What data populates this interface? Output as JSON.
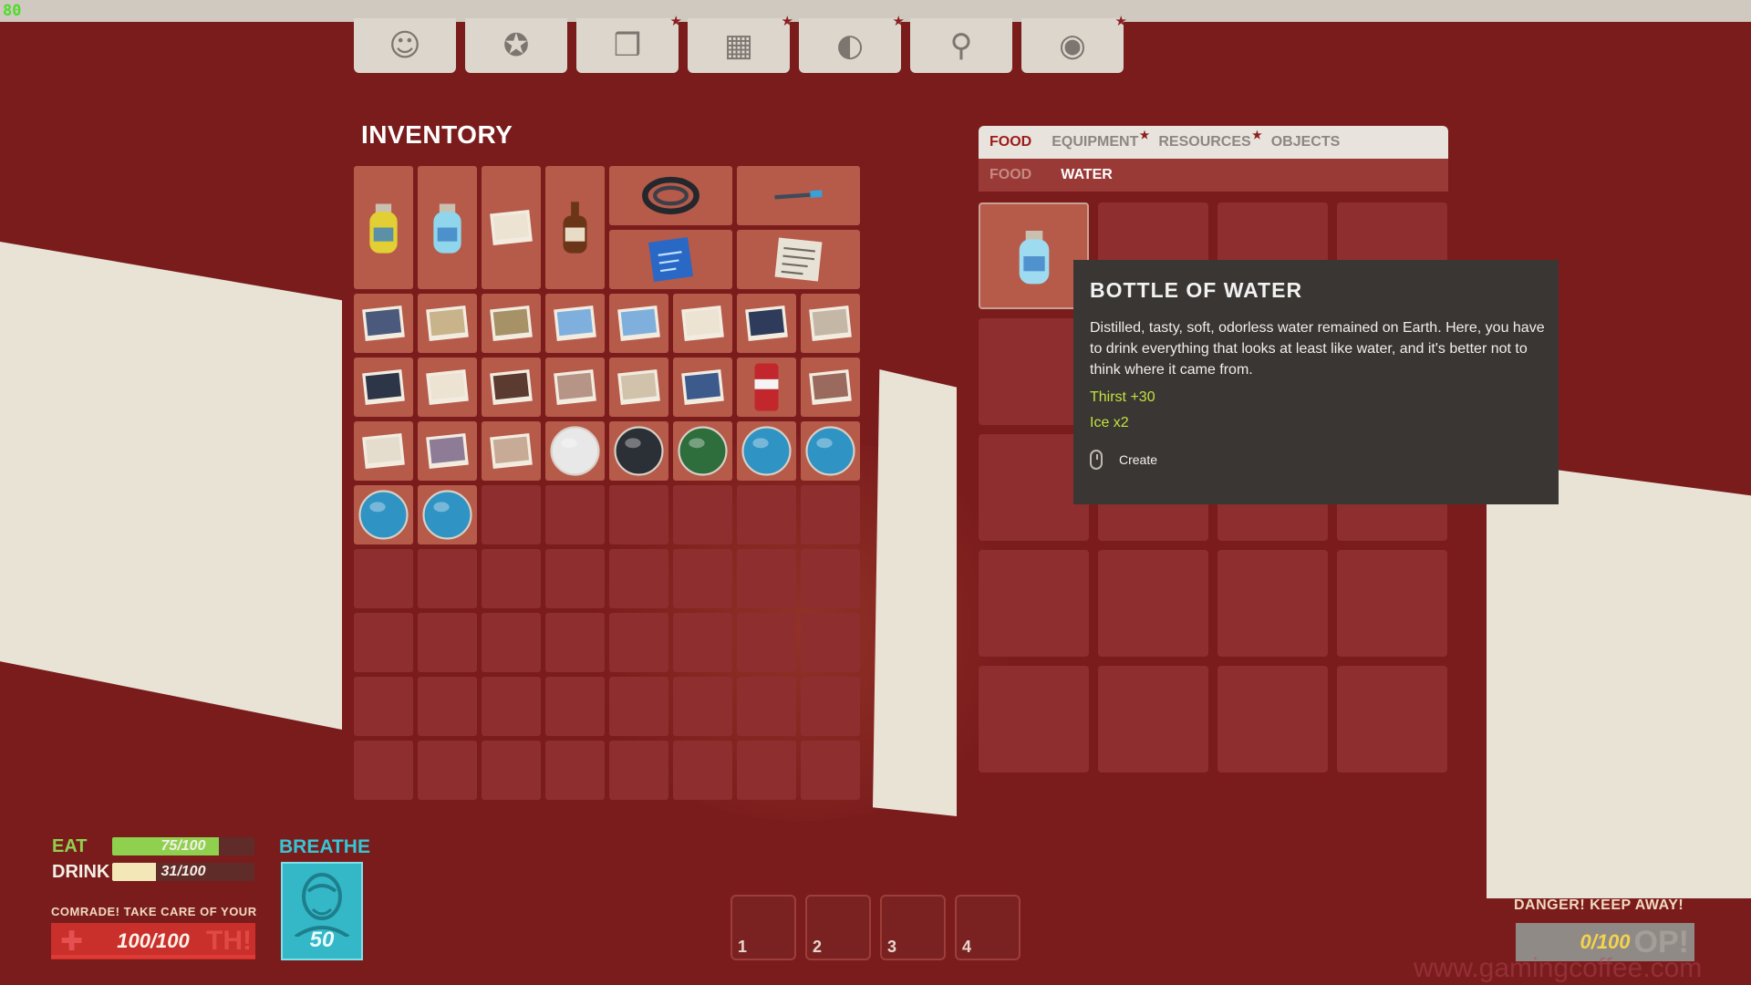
{
  "fps": "80",
  "nav": {
    "tabs": [
      {
        "id": "character",
        "icon": "character-portrait-icon",
        "glyph": "☺",
        "starred": false
      },
      {
        "id": "achievements",
        "icon": "medal-icon",
        "glyph": "✪",
        "starred": false
      },
      {
        "id": "journal",
        "icon": "open-book-icon",
        "glyph": "❒",
        "starred": true
      },
      {
        "id": "calculator",
        "icon": "calculator-icon",
        "glyph": "▦",
        "starred": true
      },
      {
        "id": "crafting",
        "icon": "tape-roll-icon",
        "glyph": "◐",
        "starred": true
      },
      {
        "id": "map",
        "icon": "map-pin-icon",
        "glyph": "⚲",
        "starred": false
      },
      {
        "id": "camera",
        "icon": "camera-icon",
        "glyph": "◉",
        "starred": true
      }
    ]
  },
  "inventory": {
    "title": "INVENTORY",
    "items": [
      {
        "name": "yellow-bottle",
        "kind": "bottle",
        "color": "#e2cf33"
      },
      {
        "name": "water-spray-bottle",
        "kind": "bottle",
        "color": "#8fd6ec"
      },
      {
        "name": "photo-card",
        "kind": "card",
        "color": "#ece3d3"
      },
      {
        "name": "beer-bottle",
        "kind": "beer",
        "color": "#6b3518"
      },
      {
        "name": "coiled-cable",
        "kind": "coil",
        "color": "#24272c"
      },
      {
        "name": "screwdriver-tool",
        "kind": "tool",
        "color": "#3d4b5a"
      },
      {
        "name": "blueprint",
        "kind": "blueprint",
        "color": "#2a68c6"
      },
      {
        "name": "newspaper",
        "kind": "newspaper",
        "color": "#e7e2d5"
      },
      {
        "name": "card-1",
        "kind": "card",
        "color": "#4b5a7c"
      },
      {
        "name": "card-2",
        "kind": "card",
        "color": "#c8b38a"
      },
      {
        "name": "card-3",
        "kind": "card",
        "color": "#a79167"
      },
      {
        "name": "card-4",
        "kind": "card",
        "color": "#7fb0dd"
      },
      {
        "name": "card-5",
        "kind": "card",
        "color": "#7fb0dd"
      },
      {
        "name": "card-6",
        "kind": "card",
        "color": "#ece3d3"
      },
      {
        "name": "card-7",
        "kind": "card",
        "color": "#2e3b5a"
      },
      {
        "name": "card-8",
        "kind": "card",
        "color": "#c4b7a6"
      },
      {
        "name": "card-9",
        "kind": "card",
        "color": "#2d3648"
      },
      {
        "name": "card-10",
        "kind": "card",
        "color": "#ece3d3"
      },
      {
        "name": "card-11",
        "kind": "card",
        "color": "#5b3a30"
      },
      {
        "name": "card-12",
        "kind": "card",
        "color": "#b79586"
      },
      {
        "name": "card-13",
        "kind": "card",
        "color": "#d1c2ab"
      },
      {
        "name": "card-14",
        "kind": "card",
        "color": "#3d5a8c"
      },
      {
        "name": "soda-can",
        "kind": "can",
        "color": "#c1272d"
      },
      {
        "name": "card-15",
        "kind": "card",
        "color": "#9a6a5e"
      },
      {
        "name": "card-16",
        "kind": "card",
        "color": "#e4dccd"
      },
      {
        "name": "card-17",
        "kind": "card",
        "color": "#8e7c96"
      },
      {
        "name": "card-18",
        "kind": "card",
        "color": "#c7ab96"
      },
      {
        "name": "white-orb",
        "kind": "orb",
        "color": "#e8e8e8"
      },
      {
        "name": "dark-orb",
        "kind": "orb",
        "color": "#2b2f36"
      },
      {
        "name": "green-orb",
        "kind": "orb",
        "color": "#2e6d3c"
      },
      {
        "name": "blue-orb-1",
        "kind": "orb",
        "color": "#2f93c4"
      },
      {
        "name": "blue-orb-2",
        "kind": "orb",
        "color": "#2f93c4"
      },
      {
        "name": "blue-orb-3",
        "kind": "orb",
        "color": "#2f93c4"
      },
      {
        "name": "blue-orb-4",
        "kind": "orb",
        "color": "#2f93c4"
      }
    ]
  },
  "categories": {
    "tabs": [
      {
        "label": "FOOD",
        "active": true,
        "starred": false
      },
      {
        "label": "EQUIPMENT",
        "active": false,
        "starred": true
      },
      {
        "label": "RESOURCES",
        "active": false,
        "starred": true
      },
      {
        "label": "OBJECTS",
        "active": false,
        "starred": false
      }
    ],
    "subtabs": [
      {
        "label": "FOOD",
        "active": false
      },
      {
        "label": "WATER",
        "active": true
      }
    ]
  },
  "tooltip": {
    "title": "BOTTLE OF WATER",
    "description": "Distilled, tasty, soft, odorless water remained on Earth. Here, you have to drink everything that looks at least like water, and it's better not to think where it came from.",
    "stat1": "Thirst +30",
    "stat2": "Ice x2",
    "action": "Create"
  },
  "stats": {
    "eat": {
      "label": "EAT",
      "value": "75/100",
      "fraction": 0.75,
      "color": "#8fd14f"
    },
    "drink": {
      "label": "DRINK",
      "value": "31/100",
      "fraction": 0.31,
      "color": "#f3e7b8"
    },
    "comrade_text": "COMRADE! TAKE CARE OF YOUR",
    "health_value": "100/100",
    "health_ghost": "TH!",
    "breathe_label": "BREATHE",
    "breathe_value": "50"
  },
  "hotbar": [
    "1",
    "2",
    "3",
    "4"
  ],
  "danger": {
    "label": "DANGER! KEEP AWAY!",
    "value": "0/100",
    "ghost": "OP!"
  },
  "watermark": "www.gamingcoffee.com",
  "colors": {
    "accent": "#9b1b1b",
    "background": "#7a1c1c",
    "stat_green": "#c3e23f"
  }
}
